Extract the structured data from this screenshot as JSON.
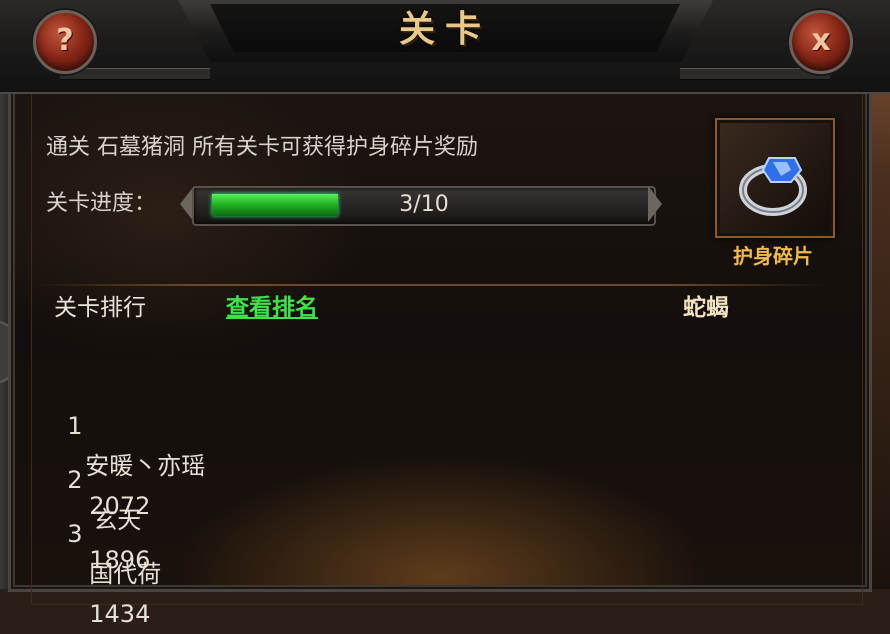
{
  "dialog": {
    "title": "关卡",
    "help_label": "?",
    "close_label": "x"
  },
  "requirement": {
    "text": "通关  石墓猪洞 所有关卡可获得护身碎片奖励"
  },
  "progress": {
    "label": "关卡进度：",
    "text": "3/10",
    "current": 3,
    "total": 10
  },
  "reward": {
    "icon": "ring-icon",
    "name": "护身碎片"
  },
  "ranking": {
    "title": "关卡排行",
    "view_link": "查看排名",
    "boss": "蛇蝎",
    "entries": [
      {
        "rank": "1",
        "name": "安暖丶亦瑶",
        "score": "2072"
      },
      {
        "rank": "2",
        "name": "玄天",
        "score": "1896"
      },
      {
        "rank": "3",
        "name": "国代荷",
        "score": "1434"
      }
    ]
  },
  "colors": {
    "accent_gold": "#f2b94b",
    "link_green": "#3fe24a",
    "progress_green": "#1fae1f"
  }
}
